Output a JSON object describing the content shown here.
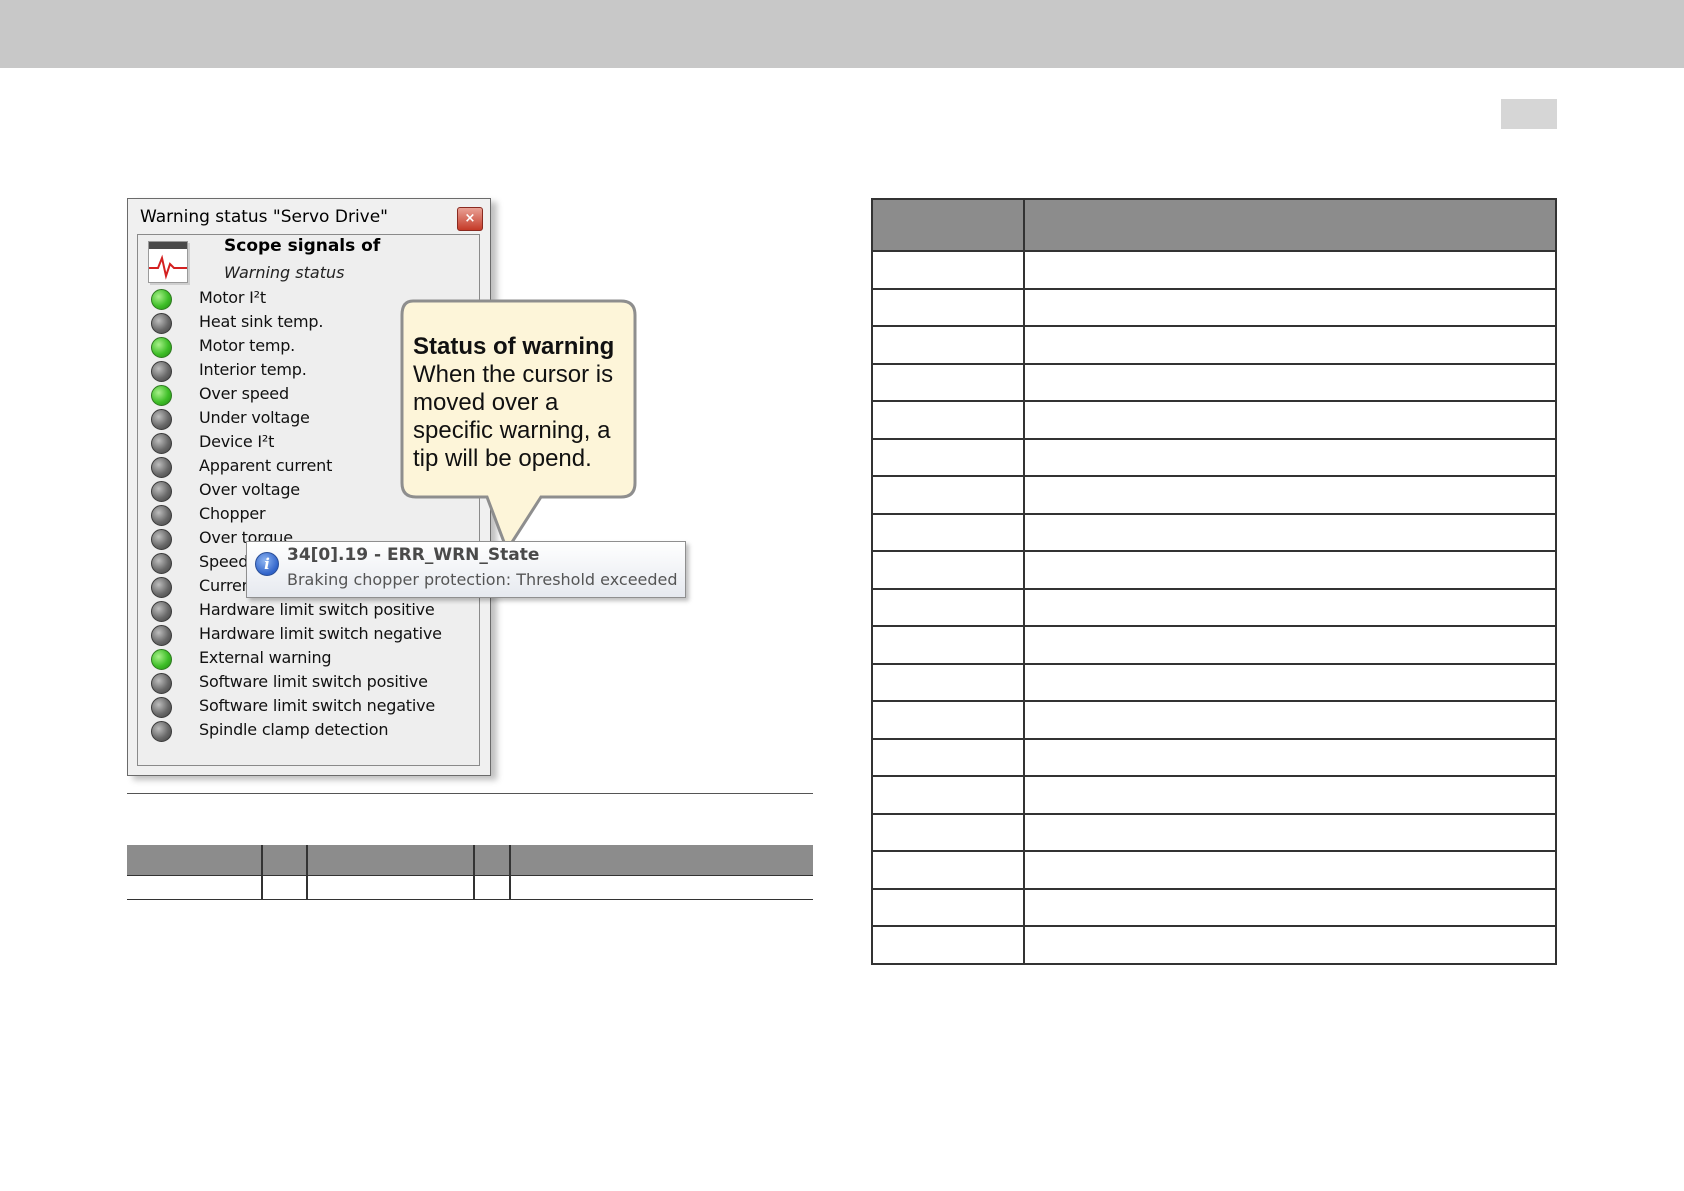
{
  "window": {
    "title": "Warning status \"Servo Drive\"",
    "close_symbol": "×",
    "scope_title": "Scope signals of",
    "scope_subtitle": "Warning status",
    "icon": "scope-signal-icon"
  },
  "signals": [
    {
      "label": "Motor I²t",
      "state": "green"
    },
    {
      "label": "Heat sink temp.",
      "state": "gray"
    },
    {
      "label": "Motor temp.",
      "state": "green"
    },
    {
      "label": "Interior temp.",
      "state": "gray"
    },
    {
      "label": "Over speed",
      "state": "green"
    },
    {
      "label": "Under voltage",
      "state": "gray"
    },
    {
      "label": "Device I²t",
      "state": "gray"
    },
    {
      "label": "Apparent current",
      "state": "gray"
    },
    {
      "label": "Over voltage",
      "state": "gray"
    },
    {
      "label": "Chopper",
      "state": "gray"
    },
    {
      "label": "Over torque",
      "state": "gray"
    },
    {
      "label": "Speed li",
      "state": "gray"
    },
    {
      "label": "Current l",
      "state": "gray"
    },
    {
      "label": "Hardware limit switch positive",
      "state": "gray"
    },
    {
      "label": "Hardware limit switch negative",
      "state": "gray"
    },
    {
      "label": "External warning",
      "state": "green"
    },
    {
      "label": "Software limit switch positive",
      "state": "gray"
    },
    {
      "label": "Software limit switch negative",
      "state": "gray"
    },
    {
      "label": "Spindle clamp detection",
      "state": "gray"
    }
  ],
  "callout": {
    "title": "Status of warning",
    "text": "When the cursor is moved over a specific warning, a tip will be opend."
  },
  "tooltip": {
    "icon": "info-icon",
    "title": "34[0].19 - ERR_WRN_State",
    "text": "Braking chopper protection:  Threshold exceeded"
  },
  "colors": {
    "top_band": "#c8c8c8",
    "table_header": "#8c8c8c",
    "led_green": "#3fbf28",
    "led_gray": "#6a6a6a",
    "callout_fill": "#fdf5d9"
  }
}
